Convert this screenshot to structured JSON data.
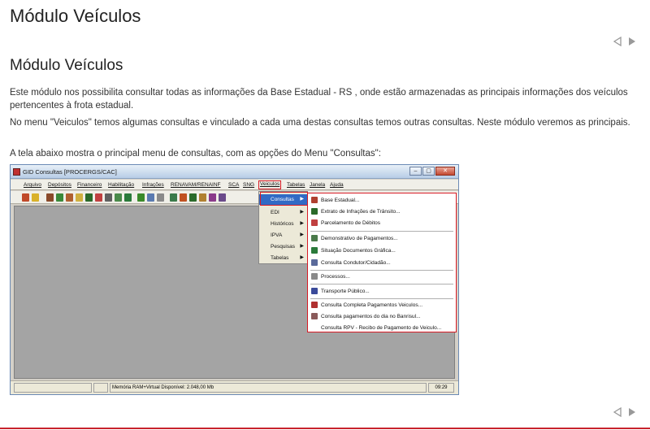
{
  "page": {
    "title": "Módulo Veículos",
    "section_title": "Módulo Veículos",
    "paragraphs": [
      "Este módulo nos possibilita consultar todas as informações da Base Estadual  - RS , onde estão armazenadas as principais informações dos veículos pertencentes à frota estadual.",
      "No menu \"Veiculos\" temos algumas consultas e vinculado a cada uma destas  consultas  temos outras consultas. Neste módulo veremos as principais.",
      "A tela abaixo mostra o principal menu de consultas, com as opções do Menu \"Consultas\":"
    ],
    "nav": {
      "prev_icon": "triangle-left-icon",
      "next_icon": "triangle-right-icon"
    },
    "accent_color": "#c8232c"
  },
  "screenshot": {
    "window_title": "GID Consultas [PROCERGS/CAC]",
    "window_buttons": [
      "–",
      "▢",
      "✕"
    ],
    "menu": [
      "Arquivo",
      "Depósitos",
      "Financeiro",
      "Habilitação",
      "Infrações",
      "RENAVAM/RENAINF",
      "SCA",
      "SNG",
      "Veiculos",
      "Tabelas",
      "Janela",
      "Ajuda"
    ],
    "submenu": [
      {
        "label": "Consultas",
        "has_arrow": true
      },
      {
        "label": "EDI",
        "has_arrow": true
      },
      {
        "label": "Históricos",
        "has_arrow": true
      },
      {
        "label": "IPVA",
        "has_arrow": true
      },
      {
        "label": "Pesquisas",
        "has_arrow": true
      },
      {
        "label": "Tabelas",
        "has_arrow": true
      }
    ],
    "consultas_items": [
      "Base Estadual...",
      "Extrato de Infrações de Trânsito...",
      "Parcelamento de Débitos",
      "Demonstrativo de Pagamentos...",
      "Situação Documentos Gráfica...",
      "Consulta Condutor/Cidadão...",
      "Processos...",
      "Transporte Público...",
      "Consulta Completa Pagamentos Veiculos...",
      "Consulta pagamentos do dia no Banrisul...",
      "Consulta RPV - Recibo de Pagamento de Veiculo..."
    ],
    "status": {
      "memory": "Memória RAM+Virtual Disponível: 2.048,00 Mb",
      "time": "09:29"
    }
  }
}
